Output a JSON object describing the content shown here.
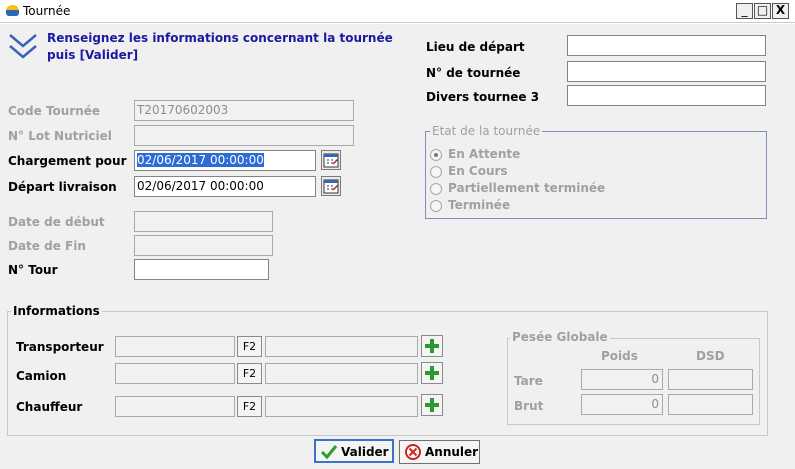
{
  "window": {
    "title": "Tournée",
    "minimize": "_",
    "restore": "□",
    "close": "X"
  },
  "instruction": {
    "line1": "Renseignez les informations concernant la tournée",
    "line2": "puis [Valider]"
  },
  "fields": {
    "code_tournee": {
      "label": "Code Tournée",
      "value": "T20170602003"
    },
    "lot_nutriciel": {
      "label": "N° Lot Nutriciel",
      "value": ""
    },
    "chargement_pour": {
      "label": "Chargement pour",
      "value": "02/06/2017 00:00:00"
    },
    "depart_livraison": {
      "label": "Départ livraison",
      "value": "02/06/2017 00:00:00"
    },
    "date_debut": {
      "label": "Date de début",
      "value": ""
    },
    "date_fin": {
      "label": "Date de Fin",
      "value": ""
    },
    "n_tour": {
      "label": "N° Tour",
      "value": ""
    },
    "lieu_depart": {
      "label": "Lieu de départ",
      "value": ""
    },
    "n_tournee": {
      "label": "N° de tournée",
      "value": ""
    },
    "divers_tournee_3": {
      "label": "Divers tournee 3",
      "value": ""
    }
  },
  "etat": {
    "title": "Etat de la tournée",
    "options": [
      "En Attente",
      "En Cours",
      "Partiellement terminée",
      "Terminée"
    ],
    "selected": "En Attente"
  },
  "informations": {
    "title": "Informations",
    "rows": [
      {
        "label": "Transporteur",
        "code": "",
        "name": "",
        "f2": "F2"
      },
      {
        "label": "Camion",
        "code": "",
        "name": "",
        "f2": "F2"
      },
      {
        "label": "Chauffeur",
        "code": "",
        "name": "",
        "f2": "F2"
      }
    ]
  },
  "pesee": {
    "title": "Pesée Globale",
    "col_poids": "Poids",
    "col_dsd": "DSD",
    "rows": [
      {
        "label": "Tare",
        "poids": "0",
        "dsd": ""
      },
      {
        "label": "Brut",
        "poids": "0",
        "dsd": ""
      }
    ]
  },
  "buttons": {
    "valider": "Valider",
    "annuler": "Annuler"
  },
  "colors": {
    "instruction_text": "#1a1aa0",
    "selection": "#2d6cd6",
    "plus_green": "#2a9a2a",
    "check_green": "#2e9e2e",
    "cancel_red": "#d02020"
  }
}
